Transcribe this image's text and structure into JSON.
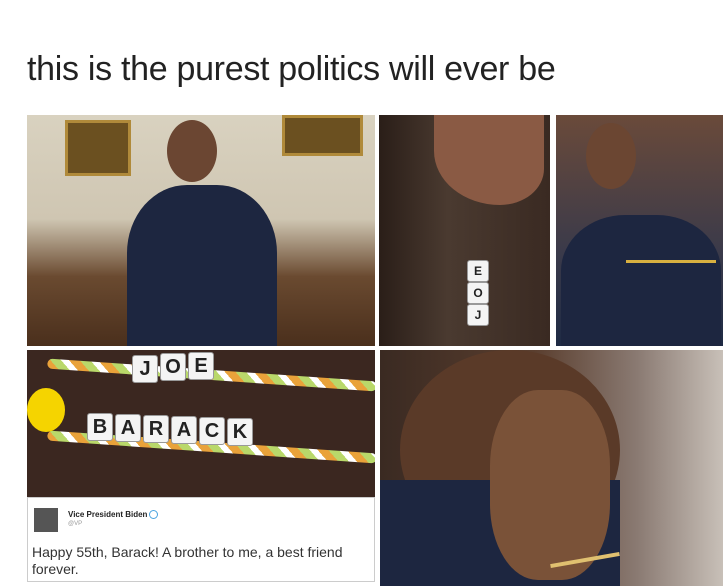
{
  "caption": "this is the purest politics will ever be",
  "bracelet_beads": {
    "small": [
      "J",
      "O",
      "E"
    ],
    "large_top": [
      "J",
      "O",
      "E"
    ],
    "large_bottom": [
      "B",
      "A",
      "R",
      "A",
      "C",
      "K"
    ]
  },
  "tweet": {
    "name": "Vice President Biden",
    "handle": "@VP",
    "text": "Happy 55th, Barack! A brother to me, a best friend forever."
  }
}
